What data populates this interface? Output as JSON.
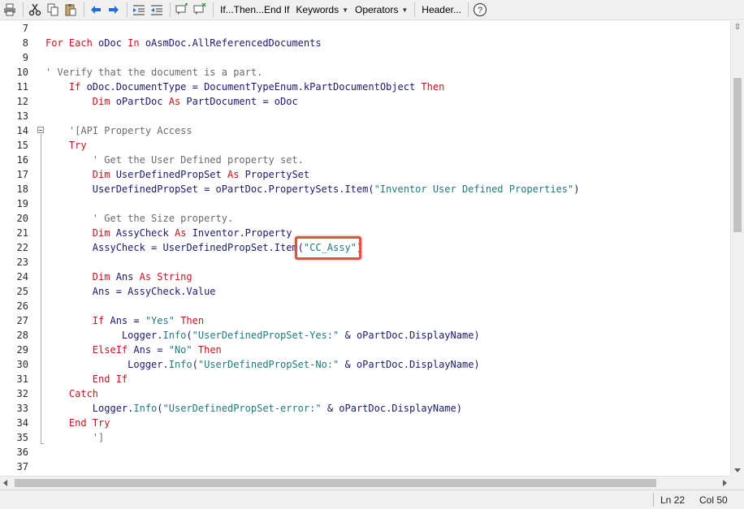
{
  "toolbar": {
    "if_then": "If...Then...End If",
    "keywords": "Keywords",
    "operators": "Operators",
    "header": "Header...",
    "help": "?"
  },
  "editor": {
    "lines": [
      {
        "num": "7",
        "segs": []
      },
      {
        "num": "8",
        "segs": [
          {
            "t": "For Each",
            "c": "kw"
          },
          {
            "t": " oDoc ",
            "c": "tx"
          },
          {
            "t": "In",
            "c": "kw"
          },
          {
            "t": " oAsmDoc.AllReferencedDocuments",
            "c": "tx"
          }
        ]
      },
      {
        "num": "9",
        "segs": []
      },
      {
        "num": "10",
        "segs": [
          {
            "t": "' Verify that the document is a part.",
            "c": "cm"
          }
        ]
      },
      {
        "num": "11",
        "segs": [
          {
            "t": "    ",
            "c": "tx"
          },
          {
            "t": "If",
            "c": "kw"
          },
          {
            "t": " oDoc.DocumentType = DocumentTypeEnum.kPartDocumentObject ",
            "c": "tx"
          },
          {
            "t": "Then",
            "c": "kw"
          }
        ]
      },
      {
        "num": "12",
        "segs": [
          {
            "t": "        ",
            "c": "tx"
          },
          {
            "t": "Dim",
            "c": "kw"
          },
          {
            "t": " oPartDoc ",
            "c": "tx"
          },
          {
            "t": "As",
            "c": "kw"
          },
          {
            "t": " PartDocument = oDoc",
            "c": "tx"
          }
        ]
      },
      {
        "num": "13",
        "segs": []
      },
      {
        "num": "14",
        "segs": [
          {
            "t": "    '[API Property Access",
            "c": "cm"
          }
        ]
      },
      {
        "num": "15",
        "segs": [
          {
            "t": "    ",
            "c": "tx"
          },
          {
            "t": "Try",
            "c": "kw"
          }
        ]
      },
      {
        "num": "16",
        "segs": [
          {
            "t": "        ' Get the User Defined property set.",
            "c": "cm"
          }
        ]
      },
      {
        "num": "17",
        "segs": [
          {
            "t": "        ",
            "c": "tx"
          },
          {
            "t": "Dim",
            "c": "kw"
          },
          {
            "t": " UserDefinedPropSet ",
            "c": "tx"
          },
          {
            "t": "As",
            "c": "kw"
          },
          {
            "t": " PropertySet",
            "c": "tx"
          }
        ]
      },
      {
        "num": "18",
        "segs": [
          {
            "t": "        UserDefinedPropSet = oPartDoc.PropertySets.Item(",
            "c": "tx"
          },
          {
            "t": "\"Inventor User Defined Properties\"",
            "c": "st"
          },
          {
            "t": ")",
            "c": "tx"
          }
        ]
      },
      {
        "num": "19",
        "segs": []
      },
      {
        "num": "20",
        "segs": [
          {
            "t": "        ' Get the Size property.",
            "c": "cm"
          }
        ]
      },
      {
        "num": "21",
        "segs": [
          {
            "t": "        ",
            "c": "tx"
          },
          {
            "t": "Dim",
            "c": "kw"
          },
          {
            "t": " AssyCheck ",
            "c": "tx"
          },
          {
            "t": "As",
            "c": "kw"
          },
          {
            "t": " Inventor.Property",
            "c": "tx"
          }
        ]
      },
      {
        "num": "22",
        "segs": [
          {
            "t": "        AssyCheck = UserDefinedPropSet.Item(",
            "c": "tx"
          },
          {
            "t": "\"CC_Assy\"",
            "c": "st"
          },
          {
            "t": ")",
            "c": "tx"
          }
        ]
      },
      {
        "num": "23",
        "segs": []
      },
      {
        "num": "24",
        "segs": [
          {
            "t": "        ",
            "c": "tx"
          },
          {
            "t": "Dim",
            "c": "kw"
          },
          {
            "t": " Ans ",
            "c": "tx"
          },
          {
            "t": "As String",
            "c": "kw"
          }
        ]
      },
      {
        "num": "25",
        "segs": [
          {
            "t": "        Ans = AssyCheck.Value",
            "c": "tx"
          }
        ]
      },
      {
        "num": "26",
        "segs": []
      },
      {
        "num": "27",
        "segs": [
          {
            "t": "        ",
            "c": "tx"
          },
          {
            "t": "If",
            "c": "kw"
          },
          {
            "t": " Ans = ",
            "c": "tx"
          },
          {
            "t": "\"Yes\"",
            "c": "st"
          },
          {
            "t": " ",
            "c": "tx"
          },
          {
            "t": "Then",
            "c": "kw"
          }
        ]
      },
      {
        "num": "28",
        "segs": [
          {
            "t": "             Logger.",
            "c": "tx"
          },
          {
            "t": "Info",
            "c": "st"
          },
          {
            "t": "(",
            "c": "tx"
          },
          {
            "t": "\"UserDefinedPropSet-Yes:\"",
            "c": "st"
          },
          {
            "t": " & oPartDoc.DisplayName)",
            "c": "tx"
          }
        ]
      },
      {
        "num": "29",
        "segs": [
          {
            "t": "        ",
            "c": "tx"
          },
          {
            "t": "ElseIf",
            "c": "kw"
          },
          {
            "t": " Ans = ",
            "c": "tx"
          },
          {
            "t": "\"No\"",
            "c": "st"
          },
          {
            "t": " ",
            "c": "tx"
          },
          {
            "t": "Then",
            "c": "kw"
          }
        ]
      },
      {
        "num": "30",
        "segs": [
          {
            "t": "              Logger.",
            "c": "tx"
          },
          {
            "t": "Info",
            "c": "st"
          },
          {
            "t": "(",
            "c": "tx"
          },
          {
            "t": "\"UserDefinedPropSet-No:\"",
            "c": "st"
          },
          {
            "t": " & oPartDoc.DisplayName)",
            "c": "tx"
          }
        ]
      },
      {
        "num": "31",
        "segs": [
          {
            "t": "        ",
            "c": "tx"
          },
          {
            "t": "End If",
            "c": "kw"
          }
        ]
      },
      {
        "num": "32",
        "segs": [
          {
            "t": "    ",
            "c": "tx"
          },
          {
            "t": "Catch",
            "c": "kw"
          }
        ]
      },
      {
        "num": "33",
        "segs": [
          {
            "t": "        Logger.",
            "c": "tx"
          },
          {
            "t": "Info",
            "c": "st"
          },
          {
            "t": "(",
            "c": "tx"
          },
          {
            "t": "\"UserDefinedPropSet-error:\"",
            "c": "st"
          },
          {
            "t": " & oPartDoc.DisplayName)",
            "c": "tx"
          }
        ]
      },
      {
        "num": "34",
        "segs": [
          {
            "t": "    ",
            "c": "tx"
          },
          {
            "t": "End Try",
            "c": "kw"
          }
        ]
      },
      {
        "num": "35",
        "segs": [
          {
            "t": "        ']",
            "c": "cm"
          }
        ]
      },
      {
        "num": "36",
        "segs": []
      },
      {
        "num": "37",
        "segs": []
      }
    ]
  },
  "status": {
    "line": "Ln 22",
    "col": "Col 50"
  },
  "colors": {
    "keyword": "#c8141e",
    "comment": "#6b6b6b",
    "string": "#1f7a7a",
    "text": "#1a1a6e",
    "highlight": "#e05340"
  }
}
